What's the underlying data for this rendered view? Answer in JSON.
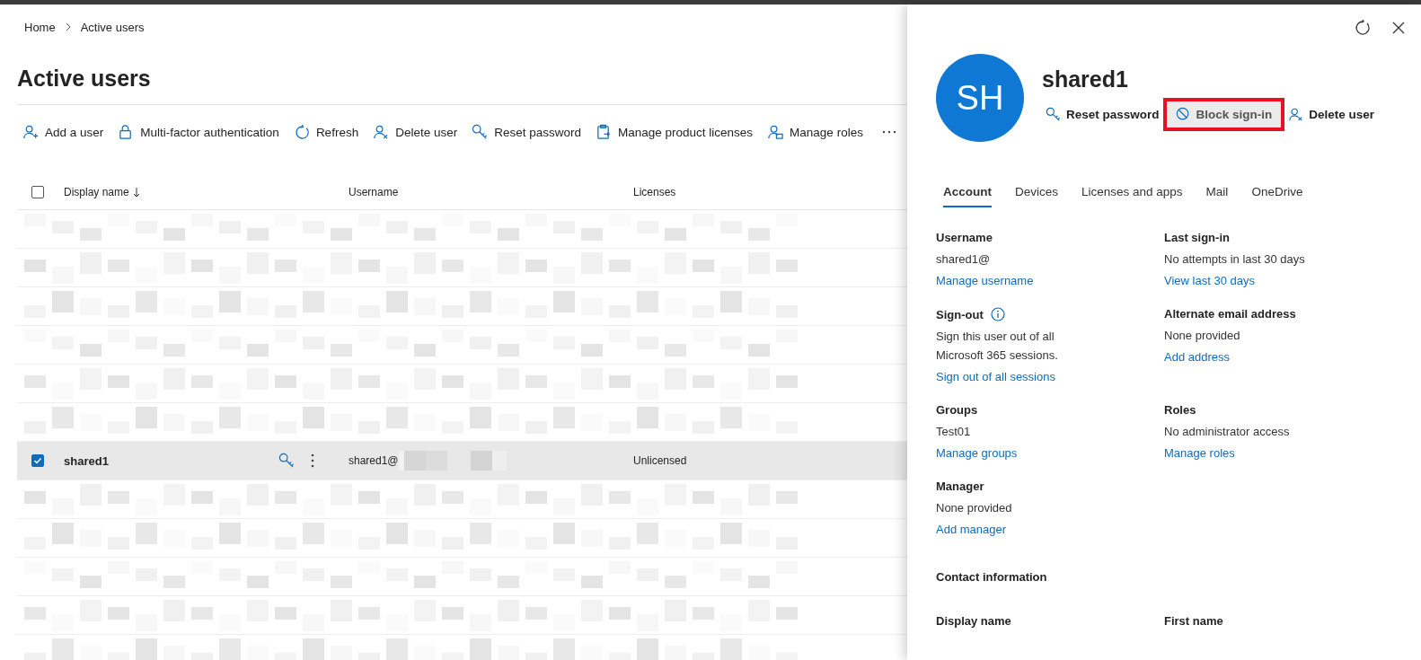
{
  "breadcrumb": [
    "Home",
    "Active users"
  ],
  "page_title": "Active users",
  "toolbar": [
    "Add a user",
    "Multi-factor authentication",
    "Refresh",
    "Delete user",
    "Reset password",
    "Manage product licenses",
    "Manage roles"
  ],
  "table": {
    "header_checked": false,
    "columns": [
      "Display name",
      "Username",
      "Licenses"
    ],
    "rows": [
      {
        "kind": "redacted"
      },
      {
        "kind": "redacted"
      },
      {
        "kind": "redacted"
      },
      {
        "kind": "redacted"
      },
      {
        "kind": "redacted"
      },
      {
        "kind": "redacted"
      },
      {
        "kind": "user",
        "selected": true,
        "display_name": "shared1",
        "username": "shared1@",
        "licenses": "Unlicensed"
      },
      {
        "kind": "redacted"
      },
      {
        "kind": "redacted"
      },
      {
        "kind": "redacted"
      },
      {
        "kind": "redacted"
      },
      {
        "kind": "redacted"
      }
    ]
  },
  "panel": {
    "avatar": "SH",
    "name": "shared1",
    "actions": [
      {
        "label": "Reset password",
        "highlighted": false
      },
      {
        "label": "Block sign-in",
        "highlighted": true
      },
      {
        "label": "Delete user",
        "highlighted": false
      }
    ],
    "tabs": [
      {
        "label": "Account",
        "selected": true
      },
      {
        "label": "Devices",
        "selected": false
      },
      {
        "label": "Licenses and apps",
        "selected": false
      },
      {
        "label": "Mail",
        "selected": false
      },
      {
        "label": "OneDrive",
        "selected": false
      }
    ],
    "sections": [
      {
        "label": "Username",
        "value": "shared1@",
        "link": "Manage username"
      },
      {
        "label": "Last sign-in",
        "value": "No attempts in last 30 days",
        "link": "View last 30 days"
      },
      {
        "label": "Sign-out",
        "info": true,
        "value": "Sign this user out of all Microsoft 365 sessions.",
        "link": "Sign out of all sessions"
      },
      {
        "label": "Alternate email address",
        "value": "None provided",
        "link": "Add address"
      },
      {
        "label": "Groups",
        "value": "Test01",
        "link": "Manage groups"
      },
      {
        "label": "Roles",
        "value": "No administrator access",
        "link": "Manage roles"
      },
      {
        "label": "Manager",
        "value": "None provided",
        "link": "Add manager"
      }
    ],
    "contact_heading": "Contact information",
    "contact_fields": [
      "Display name",
      "First name"
    ]
  }
}
